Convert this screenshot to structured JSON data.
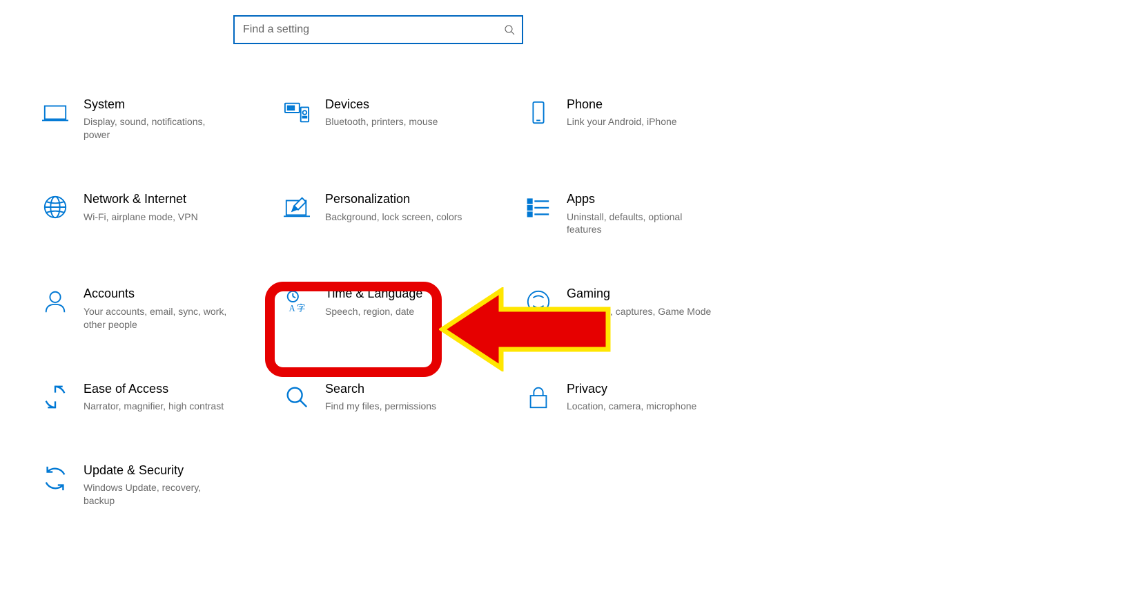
{
  "search": {
    "placeholder": "Find a setting"
  },
  "tiles": {
    "system": {
      "title": "System",
      "desc": "Display, sound, notifications, power"
    },
    "devices": {
      "title": "Devices",
      "desc": "Bluetooth, printers, mouse"
    },
    "phone": {
      "title": "Phone",
      "desc": "Link your Android, iPhone"
    },
    "network": {
      "title": "Network & Internet",
      "desc": "Wi-Fi, airplane mode, VPN"
    },
    "personalization": {
      "title": "Personalization",
      "desc": "Background, lock screen, colors"
    },
    "apps": {
      "title": "Apps",
      "desc": "Uninstall, defaults, optional features"
    },
    "accounts": {
      "title": "Accounts",
      "desc": "Your accounts, email, sync, work, other people"
    },
    "time_language": {
      "title": "Time & Language",
      "desc": "Speech, region, date"
    },
    "gaming": {
      "title": "Gaming",
      "desc": "Game Bar, captures, Game Mode"
    },
    "ease_of_access": {
      "title": "Ease of Access",
      "desc": "Narrator, magnifier, high contrast"
    },
    "search_tile": {
      "title": "Search",
      "desc": "Find my files, permissions"
    },
    "privacy": {
      "title": "Privacy",
      "desc": "Location, camera, microphone"
    },
    "update": {
      "title": "Update & Security",
      "desc": "Windows Update, recovery, backup"
    }
  },
  "colors": {
    "accent": "#0078d4",
    "highlight_border": "#e60000",
    "arrow_fill": "#e60000",
    "arrow_stroke": "#ffe600"
  }
}
